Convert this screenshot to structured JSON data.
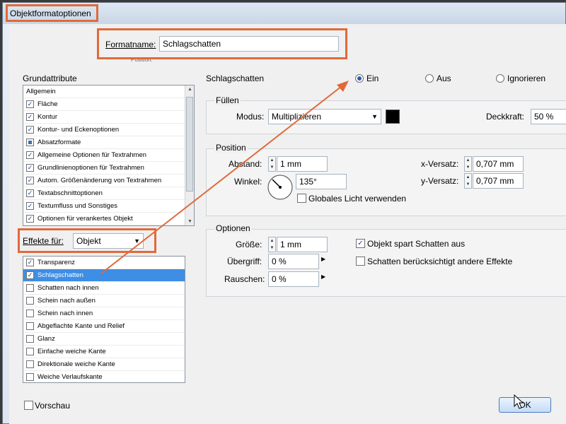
{
  "window": {
    "title": "Objektformatoptionen"
  },
  "format_name": {
    "label": "Formatname:",
    "value": "Schlagschatten",
    "hint": "Position:"
  },
  "grundattribute": {
    "heading": "Grundattribute",
    "items": [
      {
        "label": "Allgemein",
        "state": "none"
      },
      {
        "label": "Fläche",
        "state": "checked"
      },
      {
        "label": "Kontur",
        "state": "checked"
      },
      {
        "label": "Kontur- und Eckenoptionen",
        "state": "checked"
      },
      {
        "label": "Absatzformate",
        "state": "partial"
      },
      {
        "label": "Allgemeine Optionen für Textrahmen",
        "state": "checked"
      },
      {
        "label": "Grundlinienoptionen für Textrahmen",
        "state": "checked"
      },
      {
        "label": "Autom. Größenänderung von Textrahmen",
        "state": "checked"
      },
      {
        "label": "Textabschnittoptionen",
        "state": "checked"
      },
      {
        "label": "Textumfluss und Sonstiges",
        "state": "checked"
      },
      {
        "label": "Optionen für verankertes Objekt",
        "state": "checked"
      }
    ]
  },
  "effekte": {
    "label": "Effekte für:",
    "selected": "Objekt",
    "items": [
      {
        "label": "Transparenz",
        "checked": true,
        "selected": false
      },
      {
        "label": "Schlagschatten",
        "checked": true,
        "selected": true
      },
      {
        "label": "Schatten nach innen",
        "checked": false,
        "selected": false
      },
      {
        "label": "Schein nach außen",
        "checked": false,
        "selected": false
      },
      {
        "label": "Schein nach innen",
        "checked": false,
        "selected": false
      },
      {
        "label": "Abgeflachte Kante und Relief",
        "checked": false,
        "selected": false
      },
      {
        "label": "Glanz",
        "checked": false,
        "selected": false
      },
      {
        "label": "Einfache weiche Kante",
        "checked": false,
        "selected": false
      },
      {
        "label": "Direktionale weiche Kante",
        "checked": false,
        "selected": false
      },
      {
        "label": "Weiche Verlaufskante",
        "checked": false,
        "selected": false
      }
    ]
  },
  "schlagschatten": {
    "heading": "Schlagschatten",
    "options": [
      "Ein",
      "Aus",
      "Ignorieren"
    ],
    "selected": "Ein"
  },
  "fuellen": {
    "heading": "Füllen",
    "modus_label": "Modus:",
    "modus_value": "Multiplizieren",
    "swatch_color": "#000000",
    "deckkraft_label": "Deckkraft:",
    "deckkraft_value": "50 %"
  },
  "position": {
    "heading": "Position",
    "abstand_label": "Abstand:",
    "abstand_value": "1 mm",
    "winkel_label": "Winkel:",
    "winkel_value": "135°",
    "x_label": "x-Versatz:",
    "x_value": "0,707 mm",
    "y_label": "y-Versatz:",
    "y_value": "0,707 mm",
    "global_light_label": "Globales Licht verwenden",
    "global_light_checked": false
  },
  "optionen": {
    "heading": "Optionen",
    "groesse_label": "Größe:",
    "groesse_value": "1 mm",
    "uebergriff_label": "Übergriff:",
    "uebergriff_value": "0 %",
    "rauschen_label": "Rauschen:",
    "rauschen_value": "0 %",
    "objekt_spart_label": "Objekt spart Schatten aus",
    "objekt_spart_checked": true,
    "schatten_effekte_label": "Schatten berücksichtigt andere Effekte",
    "schatten_effekte_checked": false
  },
  "footer": {
    "vorschau_label": "Vorschau",
    "ok_label": "OK"
  },
  "colors": {
    "accent": "#e06a3a",
    "selection": "#3d8ee4"
  }
}
